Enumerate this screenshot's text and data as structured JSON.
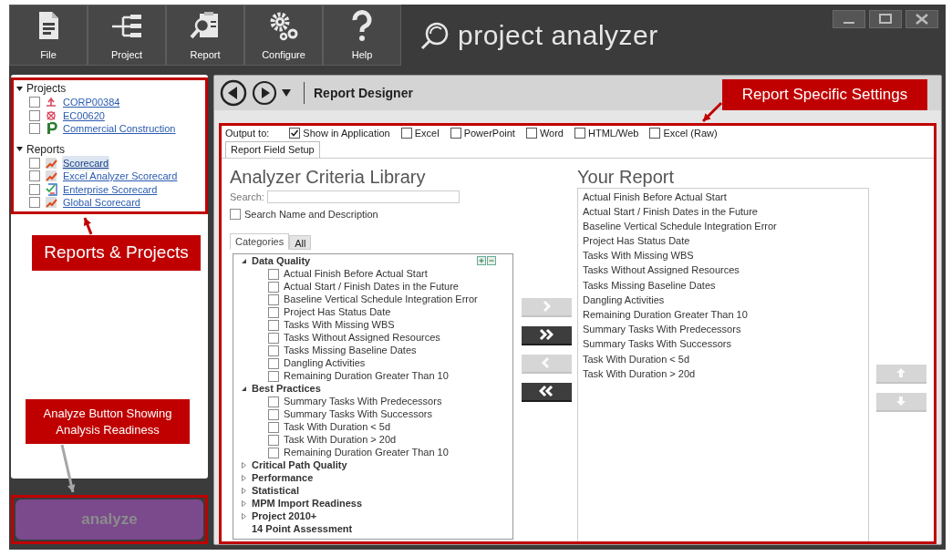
{
  "toolbar": [
    {
      "label": "File",
      "kind": "file"
    },
    {
      "label": "Project",
      "kind": "project"
    },
    {
      "label": "Report",
      "kind": "report"
    },
    {
      "label": "Configure",
      "kind": "configure"
    },
    {
      "label": "Help",
      "kind": "help"
    }
  ],
  "app_title": "project analyzer",
  "sidebar": {
    "sections": [
      {
        "title": "Projects",
        "expanded": true,
        "items": [
          {
            "label": "CORP00384",
            "kind": "schedule",
            "checked": false,
            "selected": false
          },
          {
            "label": "EC00620",
            "kind": "schedule-x",
            "checked": false,
            "selected": false
          },
          {
            "label": "Commercial Construction",
            "kind": "p-file",
            "checked": false,
            "selected": false
          }
        ]
      },
      {
        "title": "Reports",
        "expanded": true,
        "items": [
          {
            "label": "Scorecard",
            "kind": "chart",
            "checked": false,
            "selected": true
          },
          {
            "label": "Excel Analyzer Scorecard",
            "kind": "chart",
            "checked": false,
            "selected": false
          },
          {
            "label": "Enterprise Scorecard",
            "kind": "checklist",
            "checked": false,
            "selected": false
          },
          {
            "label": "Global Scorecard",
            "kind": "chart",
            "checked": false,
            "selected": false
          }
        ]
      }
    ]
  },
  "analyze_button": {
    "label": "analyze",
    "disabled": true
  },
  "designer": {
    "title": "Report Designer",
    "output_label": "Output to:",
    "outputs": [
      {
        "label": "Show in Application",
        "checked": true
      },
      {
        "label": "Excel",
        "checked": false
      },
      {
        "label": "PowerPoint",
        "checked": false
      },
      {
        "label": "Word",
        "checked": false
      },
      {
        "label": "HTML/Web",
        "checked": false
      },
      {
        "label": "Excel (Raw)",
        "checked": false
      }
    ],
    "tabs": [
      {
        "label": "Report Field Setup",
        "selected": true
      }
    ],
    "library": {
      "title": "Analyzer Criteria Library",
      "search_label": "Search:",
      "search_name": {
        "label": "Search Name and Description",
        "checked": false
      },
      "tabs": [
        {
          "label": "Categories",
          "selected": true
        },
        {
          "label": "All",
          "selected": false
        }
      ],
      "tree": [
        {
          "label": "Data Quality",
          "expanded": true,
          "children": [
            {
              "label": "Actual Finish Before Actual Start",
              "checked": false
            },
            {
              "label": "Actual Start / Finish Dates in the Future",
              "checked": false
            },
            {
              "label": "Baseline Vertical Schedule Integration Error",
              "checked": false
            },
            {
              "label": "Project Has Status Date",
              "checked": false
            },
            {
              "label": "Tasks With Missing WBS",
              "checked": false
            },
            {
              "label": "Tasks Without Assigned Resources",
              "checked": false
            },
            {
              "label": "Tasks Missing Baseline Dates",
              "checked": false
            },
            {
              "label": "Dangling Activities",
              "checked": false
            },
            {
              "label": "Remaining Duration Greater Than 10",
              "checked": false
            }
          ]
        },
        {
          "label": "Best Practices",
          "expanded": true,
          "children": [
            {
              "label": "Summary Tasks With Predecessors",
              "checked": false
            },
            {
              "label": "Summary Tasks With Successors",
              "checked": false
            },
            {
              "label": "Task With Duration < 5d",
              "checked": false
            },
            {
              "label": "Task With Duration > 20d",
              "checked": false
            },
            {
              "label": "Remaining Duration Greater Than 10",
              "checked": false
            }
          ]
        },
        {
          "label": "Critical Path Quality",
          "expanded": false
        },
        {
          "label": "Performance",
          "expanded": false
        },
        {
          "label": "Statistical",
          "expanded": false
        },
        {
          "label": "MPM Import Readiness",
          "expanded": false
        },
        {
          "label": "Project 2010+",
          "expanded": false
        },
        {
          "label": "14 Point Assessment"
        }
      ]
    },
    "transfer_buttons": [
      {
        "kind": "add",
        "disabled": true
      },
      {
        "kind": "add-all",
        "disabled": false
      },
      {
        "kind": "remove",
        "disabled": true
      },
      {
        "kind": "remove-all",
        "disabled": false
      }
    ],
    "report": {
      "title": "Your Report",
      "items": [
        "Actual Finish Before Actual Start",
        "Actual Start / Finish Dates in the Future",
        "Baseline Vertical Schedule Integration Error",
        "Project Has Status Date",
        "Tasks With Missing WBS",
        "Tasks Without Assigned Resources",
        "Tasks Missing Baseline Dates",
        "Dangling Activities",
        "Remaining Duration Greater Than 10",
        "Summary Tasks With Predecessors",
        "Summary Tasks With Successors",
        "Task With Duration < 5d",
        "Task With Duration > 20d"
      ]
    },
    "order_buttons": [
      {
        "kind": "up",
        "disabled": true
      },
      {
        "kind": "down",
        "disabled": true
      }
    ]
  },
  "annotations": [
    {
      "kind": "tree",
      "text": "Reports & Projects"
    },
    {
      "kind": "analyze",
      "text": "Analyze Button Showing Analysis Readiness"
    },
    {
      "kind": "settings",
      "text": "Report Specific Settings"
    }
  ]
}
